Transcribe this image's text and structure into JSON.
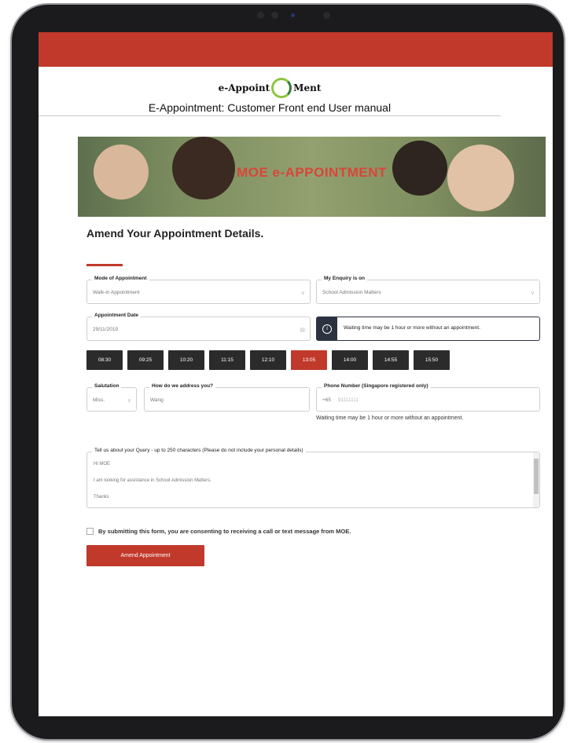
{
  "document": {
    "logo_text": "e-Appoint Ment",
    "title": "E-Appointment: Customer Front end User manual"
  },
  "banner": {
    "title": "MOE e-APPOINTMENT"
  },
  "form": {
    "heading": "Amend Your Appointment Details.",
    "mode": {
      "label": "Mode of Appointment",
      "value": "Walk-in Appointment"
    },
    "enquiry": {
      "label": "My Enquiry is on",
      "value": "School Admission Matters"
    },
    "date": {
      "label": "Appointment Date",
      "value": "29/11/2019"
    },
    "info_message": "Waiting time may be 1 hour or more without an appointment.",
    "time_slots": [
      "08:30",
      "09:25",
      "10:20",
      "11:15",
      "12:10",
      "13:05",
      "14:00",
      "14:55",
      "15:50"
    ],
    "selected_slot": "13:05",
    "salutation": {
      "label": "Salutation",
      "value": "Miss."
    },
    "name": {
      "label": "How do we address you?",
      "value": "Wang"
    },
    "phone": {
      "label": "Phone Number (Singapore registered only)",
      "prefix": "+65",
      "placeholder": "91111111"
    },
    "phone_note": "Waiting time may be 1 hour or more without an appointment.",
    "query": {
      "label": "Tell us about your Query - up to 250 characters (Please do not include your personal details)",
      "lines": [
        "Hi MOE",
        "I am looking for assistance in School Admission Matters.",
        "Thanks"
      ]
    },
    "consent": "By submitting this form, you are consenting to receiving a call or text message from MOE.",
    "submit_label": "Amend Appointment"
  },
  "colors": {
    "brand_red": "#c0392b",
    "dark_slot": "#2b2b2b",
    "info_dark": "#2c3240"
  }
}
